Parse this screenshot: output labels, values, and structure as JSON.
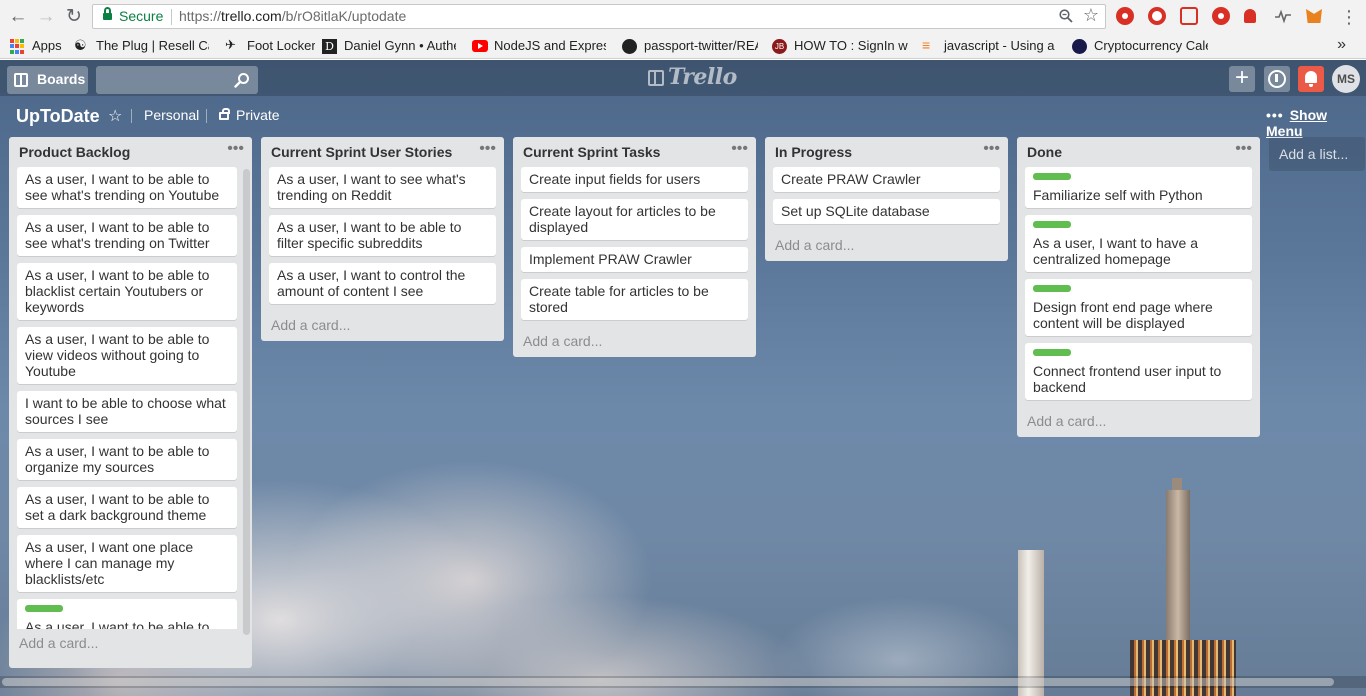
{
  "browser": {
    "secure_label": "Secure",
    "url_prefix": "https://",
    "url_main": "trello.com",
    "url_path": "/b/rO8itlaK/uptodate",
    "bookmarks": [
      {
        "label": "Apps"
      },
      {
        "label": "The Plug | Resell Cart"
      },
      {
        "label": "Foot Locker"
      },
      {
        "label": "Daniel Gynn • Authen"
      },
      {
        "label": "NodeJS and ExpressJS"
      },
      {
        "label": "passport-twitter/REA"
      },
      {
        "label": "HOW TO : SignIn with"
      },
      {
        "label": "javascript - Using a N"
      },
      {
        "label": "Cryptocurrency Calen"
      }
    ],
    "more": "»"
  },
  "header": {
    "boards_label": "Boards",
    "search_value": "",
    "logo_text": "Trello",
    "avatar_initials": "MS",
    "add_symbol": "+"
  },
  "board": {
    "title": "UpToDate",
    "star": "☆",
    "team": "Personal",
    "visibility": "Private",
    "menu_dots": "•••",
    "show_menu": "Show Menu",
    "add_list": "Add a list..."
  },
  "lists": [
    {
      "title": "Product Backlog",
      "menu": "•••",
      "add_card": "Add a card...",
      "cards": [
        {
          "text": "As a user, I want to be able to see what's trending on Youtube",
          "label": ""
        },
        {
          "text": "As a user, I want to be able to see what's trending on Twitter",
          "label": ""
        },
        {
          "text": "As a user, I want to be able to blacklist certain Youtubers or keywords",
          "label": ""
        },
        {
          "text": "As a user, I want to be able to view videos without going to Youtube",
          "label": ""
        },
        {
          "text": "I want to be able to choose what sources I see",
          "label": ""
        },
        {
          "text": "As a user, I want to be able to organize my sources",
          "label": ""
        },
        {
          "text": "As a user, I want to be able to set a dark background theme",
          "label": ""
        },
        {
          "text": "As a user, I want one place where I can manage my blacklists/etc",
          "label": ""
        },
        {
          "text": "As a user, I want to be able to switch between which content I see",
          "label": "green"
        }
      ]
    },
    {
      "title": "Current Sprint User Stories",
      "menu": "•••",
      "add_card": "Add a card...",
      "cards": [
        {
          "text": "As a user, I want to see what's trending on Reddit",
          "label": ""
        },
        {
          "text": "As a user, I want to be able to filter specific subreddits",
          "label": ""
        },
        {
          "text": "As a user, I want to control the amount of content I see",
          "label": ""
        }
      ]
    },
    {
      "title": "Current Sprint Tasks",
      "menu": "•••",
      "add_card": "Add a card...",
      "cards": [
        {
          "text": "Create input fields for users",
          "label": ""
        },
        {
          "text": "Create layout for articles to be displayed",
          "label": ""
        },
        {
          "text": "Implement PRAW Crawler",
          "label": ""
        },
        {
          "text": "Create table for articles to be stored",
          "label": ""
        }
      ]
    },
    {
      "title": "In Progress",
      "menu": "•••",
      "add_card": "Add a card...",
      "cards": [
        {
          "text": "Create PRAW Crawler",
          "label": ""
        },
        {
          "text": "Set up SQLite database",
          "label": ""
        }
      ]
    },
    {
      "title": "Done",
      "menu": "•••",
      "add_card": "Add a card...",
      "cards": [
        {
          "text": "Familiarize self with Python",
          "label": "green"
        },
        {
          "text": "As a user, I want to have a centralized homepage",
          "label": "green"
        },
        {
          "text": "Design front end page where content will be displayed",
          "label": "green"
        },
        {
          "text": "Connect frontend user input to backend",
          "label": "green"
        }
      ]
    }
  ],
  "colors": {
    "label_green": "#61bd4f",
    "notification_red": "#eb5a46",
    "secure_green": "#0b8043"
  }
}
